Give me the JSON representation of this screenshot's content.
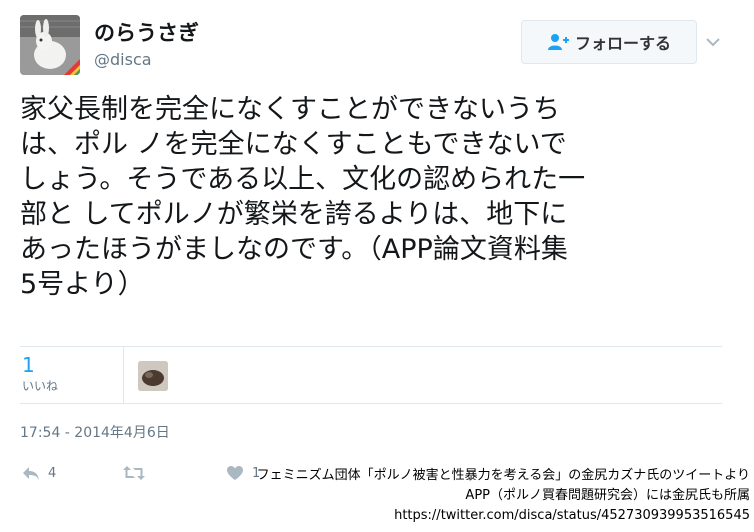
{
  "user": {
    "display_name": "のらうさぎ",
    "handle": "@disca"
  },
  "follow_button": {
    "label": "フォローする",
    "icon": "person-plus-icon"
  },
  "tweet": {
    "text": "家父長制を完全になくすことができないうち\nは、ポル ノを完全になくすこともできないで\nしょう。そうである以上、文化の認められた一\n部と してポルノが繁栄を誇るよりは、地下に\nあったほうがましなのです。（APP論文資料集\n5号より）",
    "timestamp": "17:54 - 2014年4月6日"
  },
  "stats": {
    "likes_count": "1",
    "likes_label": "いいね"
  },
  "actions": {
    "reply_count": "4",
    "retweet_count": "",
    "like_count": "1"
  },
  "caption": {
    "line1": "フェミニズム団体「ポルノ被害と性暴力を考える会」の金尻カズナ氏のツイートより",
    "line2": "APP（ポルノ買春問題研究会）には金尻氏も所属",
    "line3": "https://twitter.com/disca/status/452730939953516545"
  },
  "colors": {
    "accent": "#1da1f2",
    "muted": "#657786",
    "border": "#e1e8ed",
    "like_icon": "#aab8c2"
  }
}
